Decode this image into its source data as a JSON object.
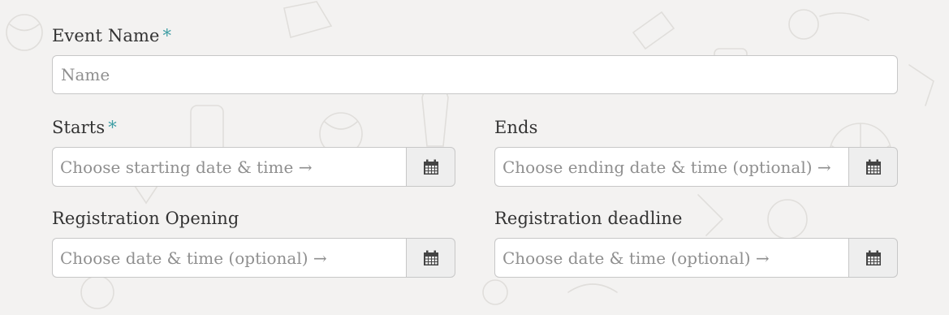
{
  "form": {
    "event_name": {
      "label": "Event Name",
      "required_marker": "*",
      "placeholder": "Name",
      "value": ""
    },
    "starts": {
      "label": "Starts",
      "required_marker": "*",
      "placeholder": "Choose starting date & time →",
      "value": "",
      "icon": "calendar-icon"
    },
    "ends": {
      "label": "Ends",
      "placeholder": "Choose ending date & time (optional) →",
      "value": "",
      "icon": "calendar-icon"
    },
    "registration_opening": {
      "label": "Registration Opening",
      "placeholder": "Choose date & time (optional) →",
      "value": "",
      "icon": "calendar-icon"
    },
    "registration_deadline": {
      "label": "Registration deadline",
      "placeholder": "Choose date & time (optional) →",
      "value": "",
      "icon": "calendar-icon"
    }
  },
  "colors": {
    "background": "#f3f2f1",
    "required_marker": "#3f9ea4",
    "input_border": "#c7c7c7",
    "addon_background": "#eeeeee",
    "placeholder_text": "#8f8f8f"
  }
}
